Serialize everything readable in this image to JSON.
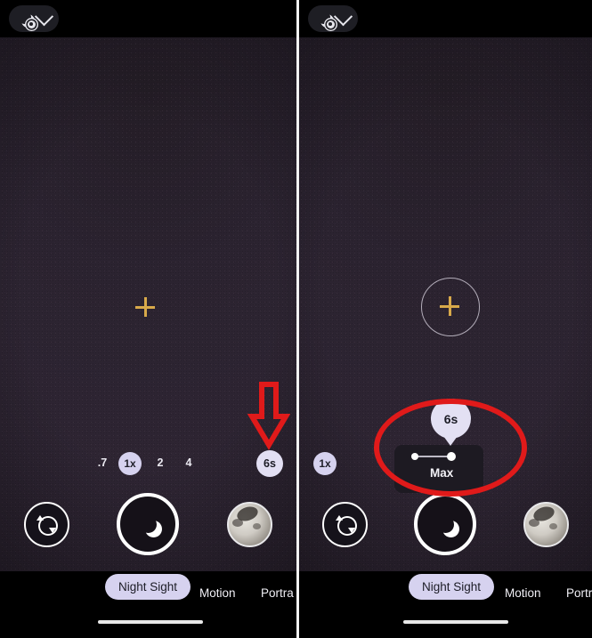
{
  "meta": {
    "app": "Google Camera — Night Sight",
    "panel_count": 2
  },
  "panel_left": {
    "topbar": {
      "settings_icon": "moon-gear-icon",
      "expand_icon": "chevron-down-icon"
    },
    "focus": {
      "marker_icon": "focus-plus-icon"
    },
    "zoom": {
      "options": [
        {
          "label": ".7",
          "selected": false
        },
        {
          "label": "1x",
          "selected": true
        },
        {
          "label": "2",
          "selected": false
        },
        {
          "label": "4",
          "selected": false
        }
      ],
      "exposure_badge": "6s"
    },
    "controls": {
      "flip_icon": "camera-flip-icon",
      "shutter_icon": "moon-icon",
      "thumbnail_icon": "moon-photo-thumbnail"
    },
    "modes": [
      {
        "label": "Night Sight",
        "active": true
      },
      {
        "label": "Motion",
        "active": false
      },
      {
        "label": "Portra",
        "active": false
      }
    ],
    "home_indicator": "home-indicator-bar"
  },
  "panel_right": {
    "topbar": {
      "settings_icon": "moon-gear-icon",
      "expand_icon": "chevron-down-icon"
    },
    "focus": {
      "marker_icon": "focus-plus-icon",
      "reticle_icon": "focus-reticle-circle"
    },
    "zoom": {
      "options": [
        {
          "label": "1x",
          "selected": true
        }
      ]
    },
    "exposure_popup": {
      "bubble_value": "6s",
      "slider_label": "Max",
      "min_dot": "slider-min-dot",
      "max_dot": "slider-max-dot"
    },
    "controls": {
      "flip_icon": "camera-flip-icon",
      "shutter_icon": "moon-icon",
      "thumbnail_icon": "moon-photo-thumbnail"
    },
    "modes": [
      {
        "label": "Night Sight",
        "active": true
      },
      {
        "label": "Motion",
        "active": false
      },
      {
        "label": "Portr",
        "active": false
      }
    ],
    "home_indicator": "home-indicator-bar"
  },
  "annotations": {
    "arrow": {
      "name": "red-down-arrow",
      "target": "exposure-badge-6s"
    },
    "ellipse": {
      "name": "red-ellipse-highlight",
      "target": "exposure-slider-popup"
    }
  },
  "colors": {
    "accent_chip": "#d6d2ef",
    "annotation_red": "#e01a1a",
    "focus_gold": "#d8a94a",
    "viewfinder": "#2b2330"
  }
}
